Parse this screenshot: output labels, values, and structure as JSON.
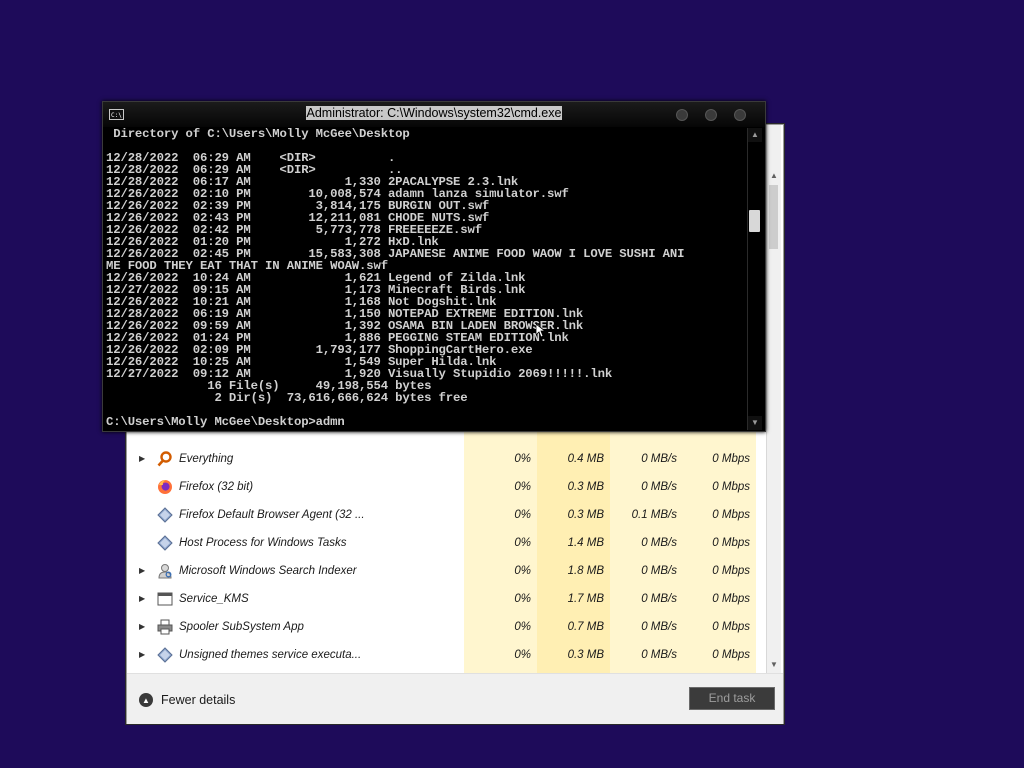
{
  "task_manager": {
    "processes": [
      {
        "name": "Everything",
        "expandable": true,
        "icon": "search-magnifier-icon",
        "cpu": "0%",
        "memory": "0.4 MB",
        "disk": "0 MB/s",
        "network": "0 Mbps"
      },
      {
        "name": "Firefox (32 bit)",
        "expandable": false,
        "icon": "firefox-icon",
        "cpu": "0%",
        "memory": "0.3 MB",
        "disk": "0 MB/s",
        "network": "0 Mbps"
      },
      {
        "name": "Firefox Default Browser Agent (32 ...",
        "expandable": false,
        "icon": "service-diamond-icon",
        "cpu": "0%",
        "memory": "0.3 MB",
        "disk": "0.1 MB/s",
        "network": "0 Mbps"
      },
      {
        "name": "Host Process for Windows Tasks",
        "expandable": false,
        "icon": "service-diamond-icon",
        "cpu": "0%",
        "memory": "1.4 MB",
        "disk": "0 MB/s",
        "network": "0 Mbps"
      },
      {
        "name": "Microsoft Windows Search Indexer",
        "expandable": true,
        "icon": "search-indexer-icon",
        "cpu": "0%",
        "memory": "1.8 MB",
        "disk": "0 MB/s",
        "network": "0 Mbps"
      },
      {
        "name": "Service_KMS",
        "expandable": true,
        "icon": "window-icon",
        "cpu": "0%",
        "memory": "1.7 MB",
        "disk": "0 MB/s",
        "network": "0 Mbps"
      },
      {
        "name": "Spooler SubSystem App",
        "expandable": true,
        "icon": "printer-icon",
        "cpu": "0%",
        "memory": "0.7 MB",
        "disk": "0 MB/s",
        "network": "0 Mbps"
      },
      {
        "name": "Unsigned themes service executa...",
        "expandable": true,
        "icon": "service-diamond-icon",
        "cpu": "0%",
        "memory": "0.3 MB",
        "disk": "0 MB/s",
        "network": "0 Mbps"
      }
    ],
    "footer": {
      "fewer_details": "Fewer details",
      "end_task": "End task"
    },
    "colors": {
      "cpu_column": "#fff6cf",
      "memory_column": "#ffefb3"
    }
  },
  "cmd": {
    "title": "Administrator: C:\\Windows\\system32\\cmd.exe",
    "icon_label": "C:\\",
    "lines": [
      " Directory of C:\\Users\\Molly McGee\\Desktop",
      "",
      "12/28/2022  06:29 AM    <DIR>          .",
      "12/28/2022  06:29 AM    <DIR>          ..",
      "12/28/2022  06:17 AM             1,330 2PACALYPSE 2.3.lnk",
      "12/26/2022  02:10 PM        10,008,574 adamn lanza simulator.swf",
      "12/26/2022  02:39 PM         3,814,175 BURGIN OUT.swf",
      "12/26/2022  02:43 PM        12,211,081 CHODE NUTS.swf",
      "12/26/2022  02:42 PM         5,773,778 FREEEEEZE.swf",
      "12/26/2022  01:20 PM             1,272 HxD.lnk",
      "12/26/2022  02:45 PM        15,583,308 JAPANESE ANIME FOOD WAOW I LOVE SUSHI ANI",
      "ME FOOD THEY EAT THAT IN ANIME WOAW.swf",
      "12/26/2022  10:24 AM             1,621 Legend of Zilda.lnk",
      "12/27/2022  09:15 AM             1,173 Minecraft Birds.lnk",
      "12/26/2022  10:21 AM             1,168 Not Dogshit.lnk",
      "12/28/2022  06:19 AM             1,150 NOTEPAD EXTREME EDITION.lnk",
      "12/26/2022  09:59 AM             1,392 OSAMA BIN LADEN BROWSER.lnk",
      "12/26/2022  01:24 PM             1,886 PEGGING STEAM EDITION.lnk",
      "12/26/2022  02:09 PM         1,793,177 ShoppingCartHero.exe",
      "12/26/2022  10:25 AM             1,549 Super Hilda.lnk",
      "12/27/2022  09:12 AM             1,920 Visually Stupidio 2069!!!!!.lnk",
      "              16 File(s)     49,198,554 bytes",
      "               2 Dir(s)  73,616,666,624 bytes free",
      "",
      "C:\\Users\\Molly McGee\\Desktop>admn"
    ]
  }
}
